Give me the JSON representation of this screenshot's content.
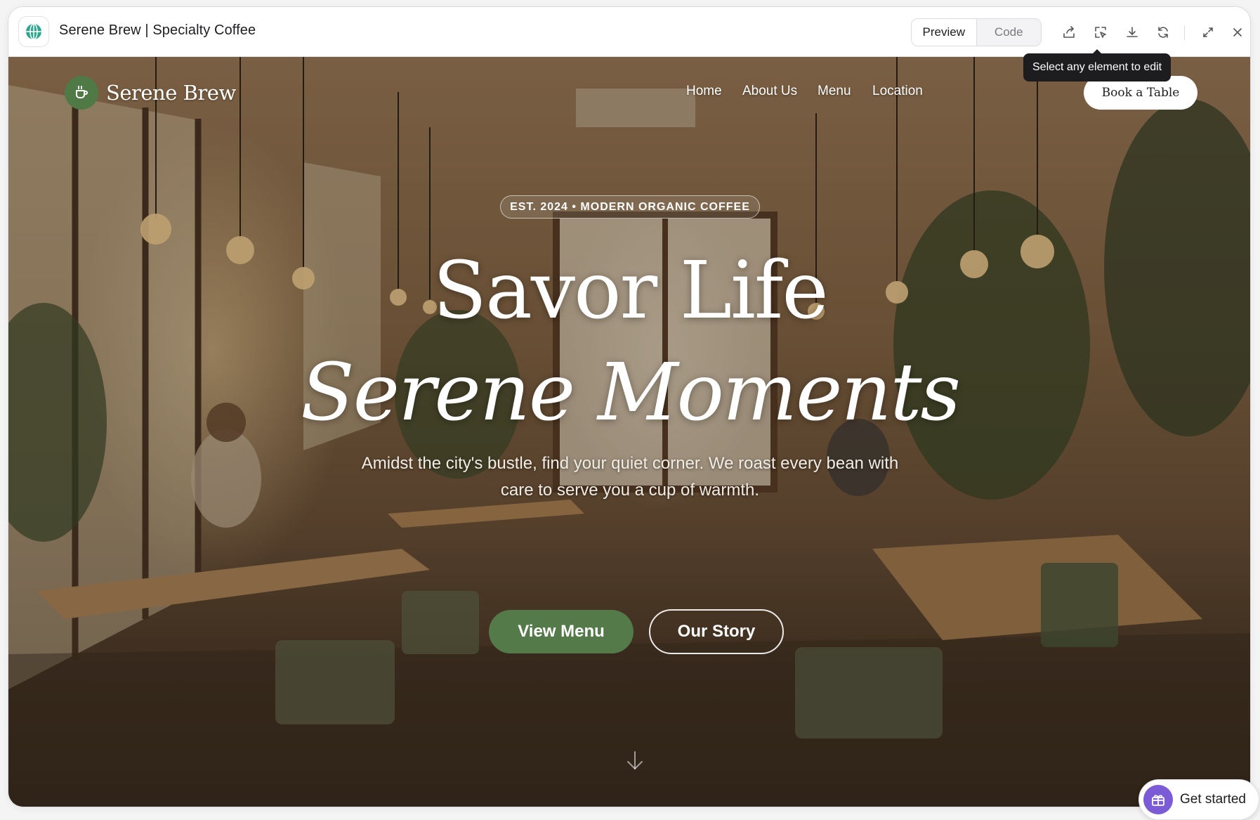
{
  "window": {
    "title": "Serene Brew | Specialty Coffee",
    "icon": "globe-icon"
  },
  "toolbar": {
    "tabs": [
      {
        "label": "Preview",
        "active": true
      },
      {
        "label": "Code",
        "active": false
      }
    ],
    "icons": [
      "share-icon",
      "select-element-icon",
      "download-icon",
      "refresh-icon",
      "expand-icon",
      "close-icon"
    ],
    "tooltip": "Select any element to edit"
  },
  "site": {
    "brand": "Serene Brew",
    "brand_icon": "coffee-cup-icon",
    "nav": [
      "Home",
      "About Us",
      "Menu",
      "Location"
    ],
    "cta": "Book a Table",
    "eyebrow": "EST. 2024 • MODERN ORGANIC COFFEE",
    "headline_line1": "Savor Life",
    "headline_line2": "Serene Moments",
    "subtitle": "Amidst the city's bustle, find your quiet corner. We roast every bean with care to serve you a cup of warmth.",
    "primary_button": "View Menu",
    "secondary_button": "Our Story",
    "scroll_icon": "arrow-down-icon"
  },
  "floating": {
    "get_started": "Get started",
    "icon": "gift-icon"
  },
  "colors": {
    "accent_green": "#557a4a",
    "brand_badge": "#4f7a46",
    "get_started_purple": "#7b5cd6"
  }
}
